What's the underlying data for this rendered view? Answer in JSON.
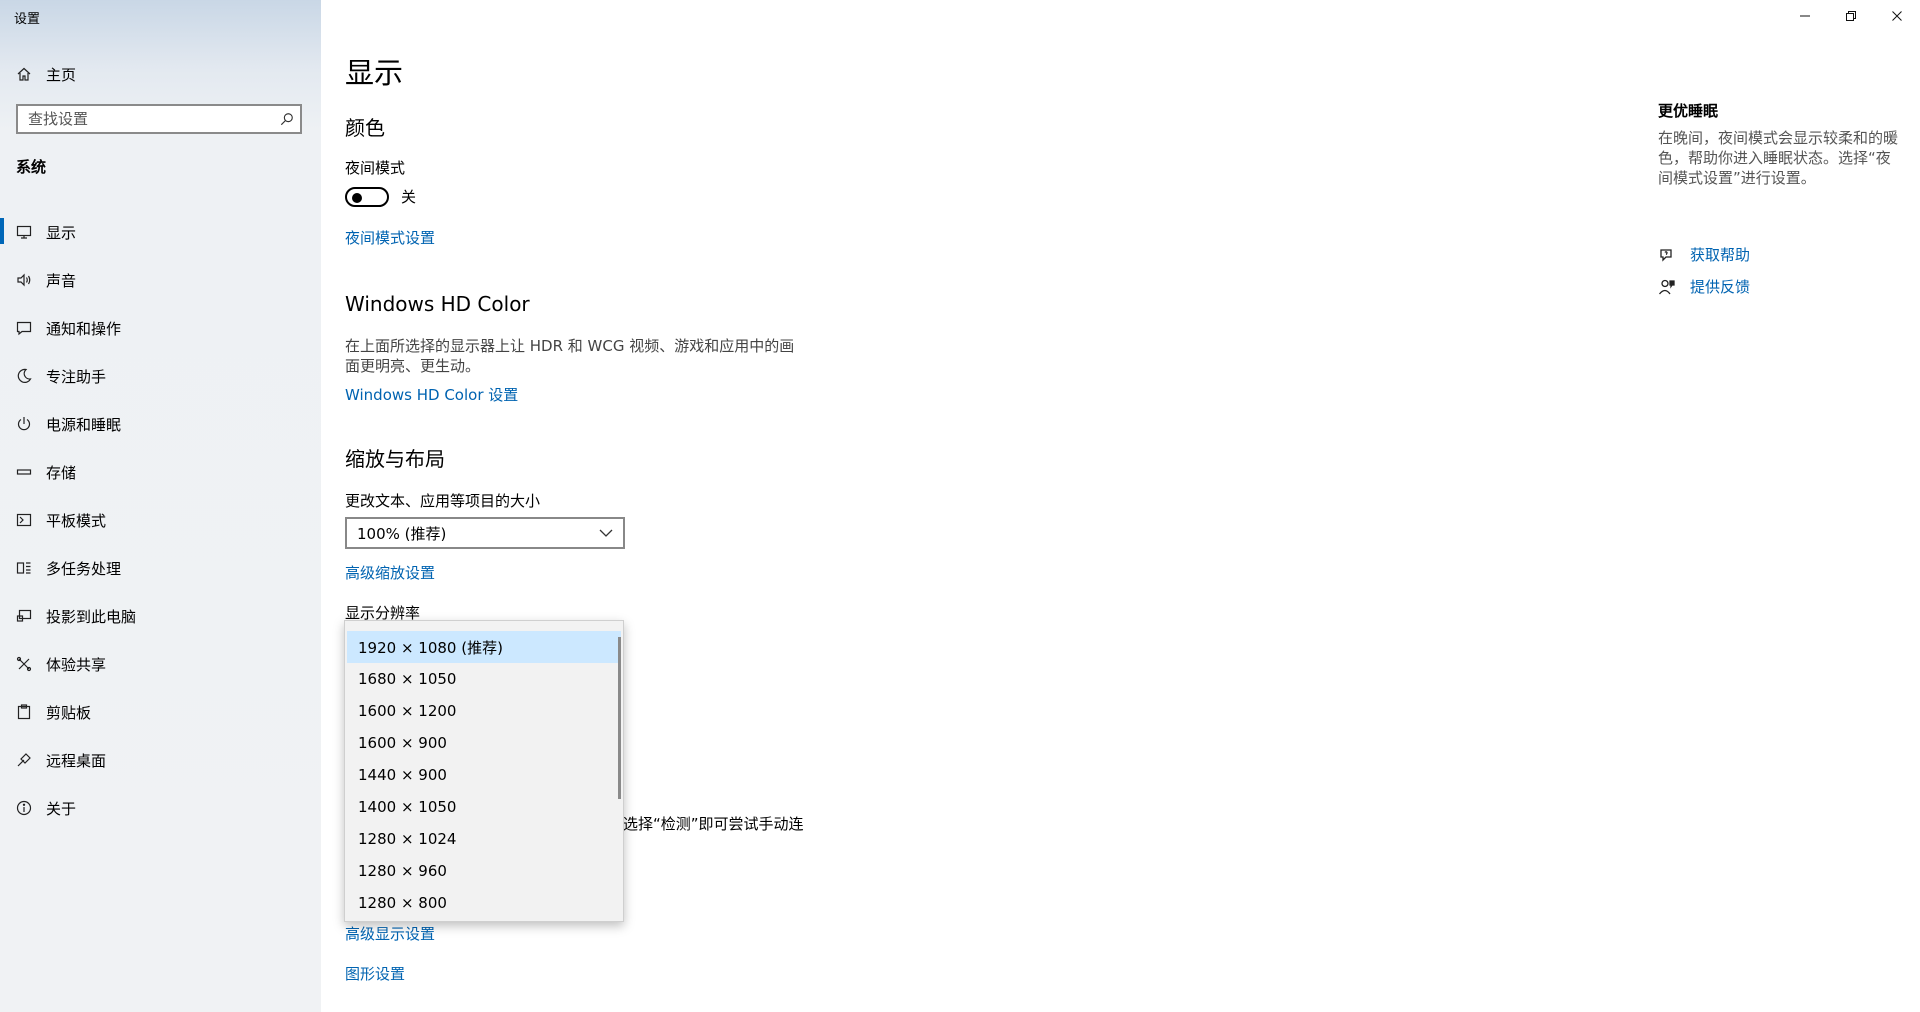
{
  "window": {
    "title": "设置"
  },
  "sidebar": {
    "home_label": "主页",
    "search_placeholder": "查找设置",
    "section": "系统",
    "items": [
      {
        "label": "显示",
        "icon": "monitor-icon"
      },
      {
        "label": "声音",
        "icon": "speaker-icon"
      },
      {
        "label": "通知和操作",
        "icon": "notification-icon"
      },
      {
        "label": "专注助手",
        "icon": "moon-icon"
      },
      {
        "label": "电源和睡眠",
        "icon": "power-icon"
      },
      {
        "label": "存储",
        "icon": "storage-icon"
      },
      {
        "label": "平板模式",
        "icon": "tablet-icon"
      },
      {
        "label": "多任务处理",
        "icon": "multitask-icon"
      },
      {
        "label": "投影到此电脑",
        "icon": "project-icon"
      },
      {
        "label": "体验共享",
        "icon": "share-icon"
      },
      {
        "label": "剪贴板",
        "icon": "clipboard-icon"
      },
      {
        "label": "远程桌面",
        "icon": "remote-icon"
      },
      {
        "label": "关于",
        "icon": "info-icon"
      }
    ]
  },
  "main": {
    "page_title": "显示",
    "color": {
      "heading": "颜色",
      "night_label": "夜间模式",
      "night_state": "关",
      "night_settings_link": "夜间模式设置"
    },
    "hdr": {
      "heading": "Windows HD Color",
      "desc": "在上面所选择的显示器上让 HDR 和 WCG 视频、游戏和应用中的画面更明亮、更生动。",
      "link": "Windows HD Color 设置"
    },
    "scale": {
      "heading": "缩放与布局",
      "size_label": "更改文本、应用等项目的大小",
      "size_value": "100% (推荐)",
      "advanced_link": "高级缩放设置",
      "resolution_label": "显示分辨率",
      "resolution_options": [
        "1920 × 1080 (推荐)",
        "1680 × 1050",
        "1600 × 1200",
        "1600 × 900",
        "1440 × 900",
        "1400 × 1050",
        "1280 × 1024",
        "1280 × 960",
        "1280 × 800"
      ]
    },
    "obscured_text": "选择“检测”即可尝试手动连",
    "advanced_display_link": "高级显示设置",
    "graphics_link": "图形设置"
  },
  "right": {
    "title": "更优睡眠",
    "desc": "在晚间，夜间模式会显示较柔和的暖色，帮助你进入睡眠状态。选择“夜间模式设置”进行设置。",
    "help_link": "获取帮助",
    "feedback_link": "提供反馈"
  }
}
